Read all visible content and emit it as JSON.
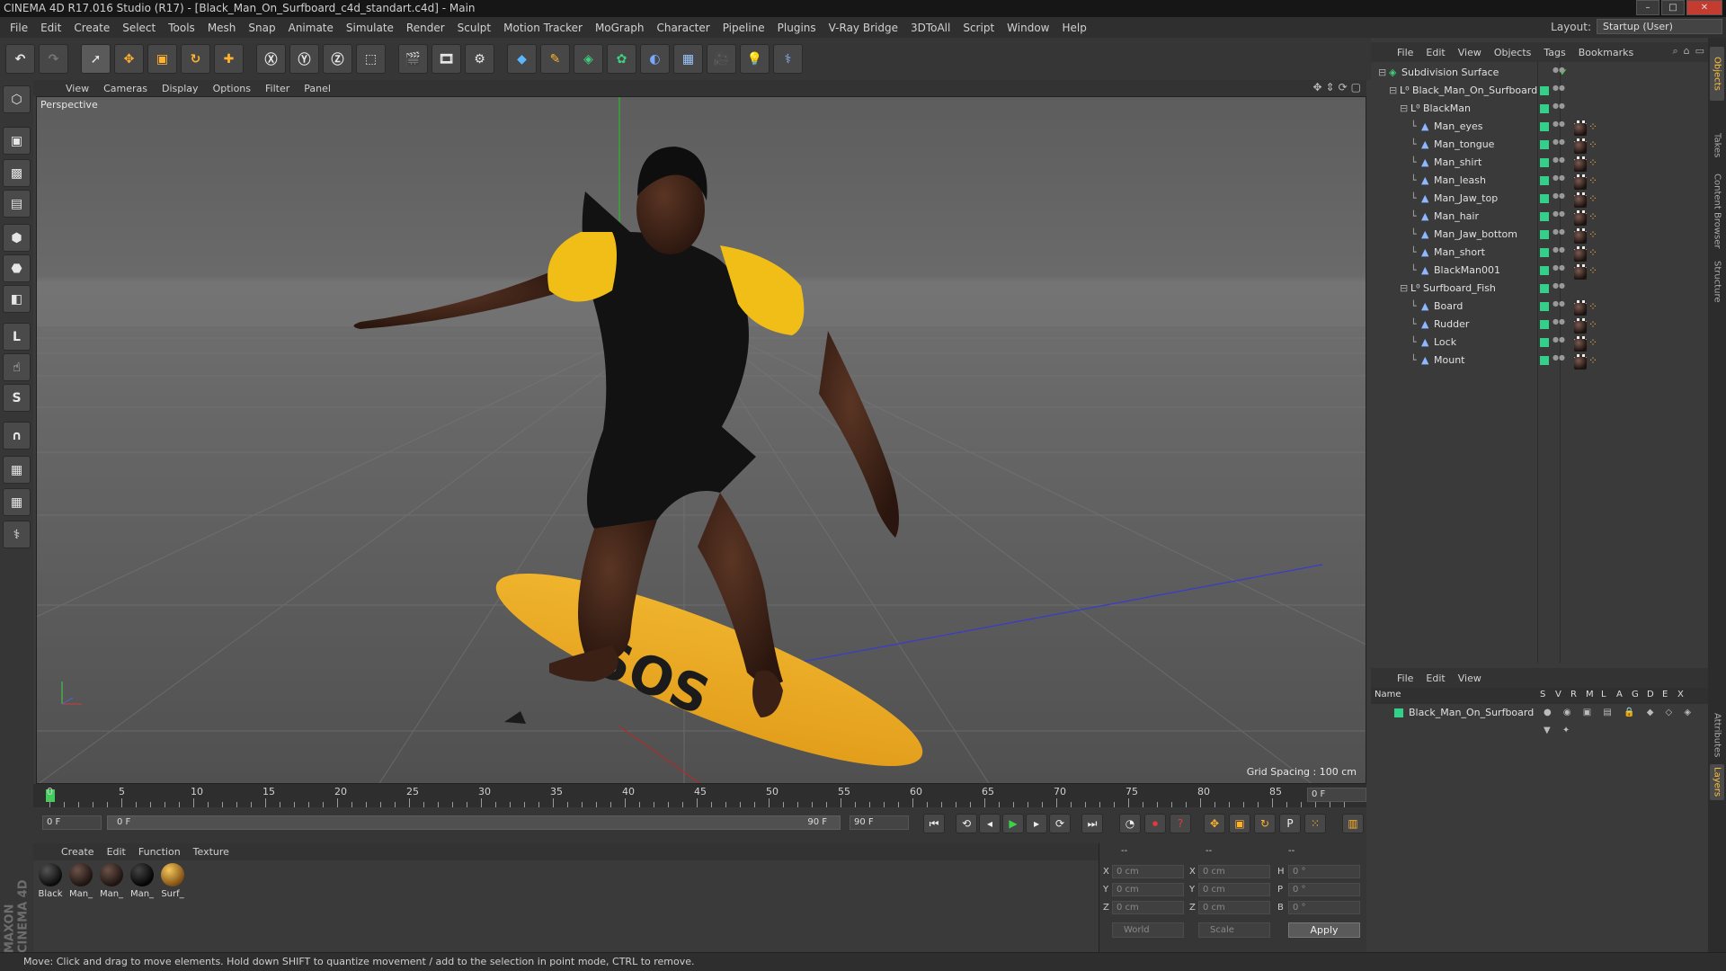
{
  "window": {
    "title": "CINEMA 4D R17.016 Studio (R17) - [Black_Man_On_Surfboard_c4d_standart.c4d] - Main"
  },
  "menubar": [
    "File",
    "Edit",
    "Create",
    "Select",
    "Tools",
    "Mesh",
    "Snap",
    "Animate",
    "Simulate",
    "Render",
    "Sculpt",
    "Motion Tracker",
    "MoGraph",
    "Character",
    "Pipeline",
    "Plugins",
    "V-Ray Bridge",
    "3DToAll",
    "Script",
    "Window",
    "Help"
  ],
  "layout": {
    "label": "Layout:",
    "value": "Startup (User)"
  },
  "viewport": {
    "menu": [
      "View",
      "Cameras",
      "Display",
      "Options",
      "Filter",
      "Panel"
    ],
    "camera_label": "Perspective",
    "grid_spacing": "Grid Spacing : 100 cm",
    "board_text": "SOS"
  },
  "timeline": {
    "ticks": [
      "0",
      "5",
      "10",
      "15",
      "20",
      "25",
      "30",
      "35",
      "40",
      "45",
      "50",
      "55",
      "60",
      "65",
      "70",
      "75",
      "80",
      "85",
      "90"
    ],
    "current_frame": "0 F",
    "start_field": "0 F",
    "range_start": "0 F",
    "range_end": "90 F",
    "end_field": "90 F"
  },
  "material_manager": {
    "menu": [
      "Create",
      "Edit",
      "Function",
      "Texture"
    ],
    "materials": [
      {
        "name": "Black"
      },
      {
        "name": "Man_"
      },
      {
        "name": "Man_"
      },
      {
        "name": "Man_"
      },
      {
        "name": "Surf_"
      }
    ]
  },
  "coordinates": {
    "header": [
      "--",
      "--",
      "--"
    ],
    "rows": [
      {
        "l1": "X",
        "v1": "0 cm",
        "l2": "X",
        "v2": "0 cm",
        "l3": "H",
        "v3": "0 °"
      },
      {
        "l1": "Y",
        "v1": "0 cm",
        "l2": "Y",
        "v2": "0 cm",
        "l3": "P",
        "v3": "0 °"
      },
      {
        "l1": "Z",
        "v1": "0 cm",
        "l2": "Z",
        "v2": "0 cm",
        "l3": "B",
        "v3": "0 °"
      }
    ],
    "space": "World",
    "mode": "Scale",
    "apply": "Apply"
  },
  "object_manager": {
    "menu": [
      "File",
      "Edit",
      "View",
      "Objects",
      "Tags",
      "Bookmarks"
    ],
    "objects": [
      {
        "name": "Subdivision Surface",
        "level": 0
      },
      {
        "name": "Black_Man_On_Surfboard",
        "level": 1
      },
      {
        "name": "BlackMan",
        "level": 2
      },
      {
        "name": "Man_eyes",
        "level": 3
      },
      {
        "name": "Man_tongue",
        "level": 3
      },
      {
        "name": "Man_shirt",
        "level": 3
      },
      {
        "name": "Man_leash",
        "level": 3
      },
      {
        "name": "Man_Jaw_top",
        "level": 3
      },
      {
        "name": "Man_hair",
        "level": 3
      },
      {
        "name": "Man_Jaw_bottom",
        "level": 3
      },
      {
        "name": "Man_short",
        "level": 3
      },
      {
        "name": "BlackMan001",
        "level": 3
      },
      {
        "name": "Surfboard_Fish",
        "level": 2
      },
      {
        "name": "Board",
        "level": 3
      },
      {
        "name": "Rudder",
        "level": 3
      },
      {
        "name": "Lock",
        "level": 3
      },
      {
        "name": "Mount",
        "level": 3
      }
    ]
  },
  "layer_manager": {
    "menu": [
      "File",
      "Edit",
      "View"
    ],
    "columns": [
      "Name",
      "S",
      "V",
      "R",
      "M",
      "L",
      "A",
      "G",
      "D",
      "E",
      "X"
    ],
    "layers": [
      {
        "name": "Black_Man_On_Surfboard",
        "color": "#33d08a"
      }
    ]
  },
  "right_tabs": [
    "Objects",
    "Takes",
    "Content Browser",
    "Structure",
    "Attributes",
    "Layers"
  ],
  "status": "Move: Click and drag to move elements. Hold down SHIFT to quantize movement / add to the selection in point mode, CTRL to remove.",
  "brand": "MAXON CINEMA 4D"
}
